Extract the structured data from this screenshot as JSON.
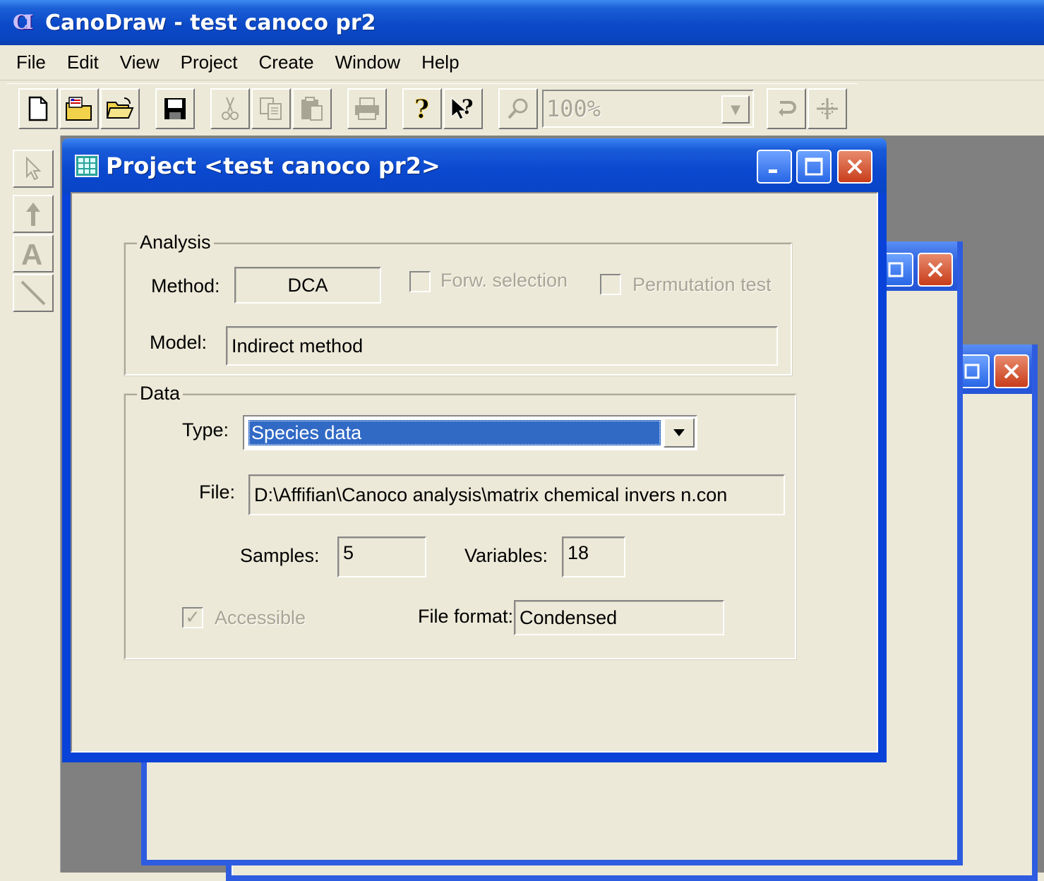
{
  "app": {
    "title": "CanoDraw - test canoco pr2",
    "icon": "canodraw-app-icon"
  },
  "menu": [
    "File",
    "Edit",
    "View",
    "Project",
    "Create",
    "Window",
    "Help"
  ],
  "toolbar": {
    "zoom": "100%"
  },
  "project_window": {
    "title": "Project <test canoco pr2>",
    "analysis": {
      "legend": "Analysis",
      "method_label": "Method:",
      "method_value": "DCA",
      "forw_selection_label": "Forw. selection",
      "permutation_label": "Permutation test",
      "model_label": "Model:",
      "model_value": "Indirect method"
    },
    "data": {
      "legend": "Data",
      "type_label": "Type:",
      "type_value": "Species data",
      "file_label": "File:",
      "file_value": "D:\\Affifian\\Canoco analysis\\matrix chemical invers n.con",
      "samples_label": "Samples:",
      "samples_value": "5",
      "variables_label": "Variables:",
      "variables_value": "18",
      "accessible_label": "Accessible",
      "accessible_checked": true,
      "format_label": "File format:",
      "format_value": "Condensed"
    }
  }
}
